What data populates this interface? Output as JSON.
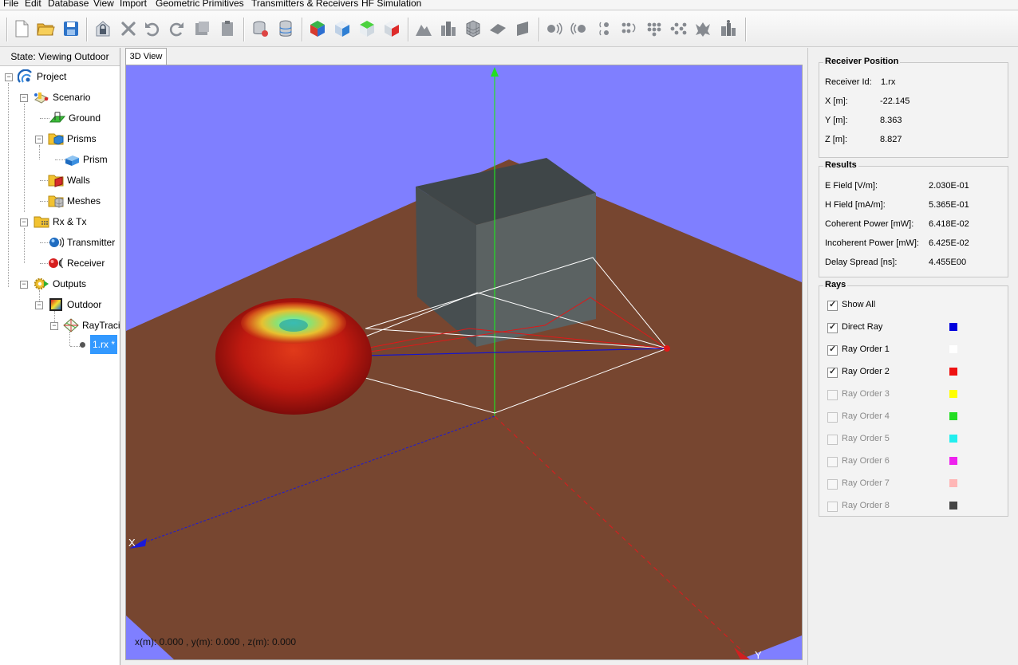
{
  "menu": [
    "File",
    "Edit",
    "Database",
    "View",
    "Import",
    "Geometric Primitives",
    "Transmitters & Receivers",
    "HF Simulation"
  ],
  "tree": {
    "state": "State: Viewing Outdoor",
    "project": "Project",
    "scenario": "Scenario",
    "ground": "Ground",
    "prisms": "Prisms",
    "prism": "Prism",
    "walls": "Walls",
    "meshes": "Meshes",
    "rxtx": "Rx & Tx",
    "transmitter": "Transmitter",
    "receiver": "Receiver",
    "outputs": "Outputs",
    "outdoor": "Outdoor",
    "raytracing": "RayTracing",
    "rx_file": "1.rx *"
  },
  "view": {
    "tab": "3D View",
    "coords": "x(m): 0.000 , y(m): 0.000 , z(m): 0.000",
    "axis_x": "X",
    "axis_y": "Y"
  },
  "receiver_position": {
    "title": "Receiver Position",
    "id_label": "Receiver Id:",
    "id_value": "1.rx",
    "x_label": "X [m]:",
    "x_value": "-22.145",
    "y_label": "Y [m]:",
    "y_value": "8.363",
    "z_label": "Z [m]:",
    "z_value": "8.827"
  },
  "results": {
    "title": "Results",
    "rows": [
      {
        "label": "E Field [V/m]:",
        "value": "2.030E-01"
      },
      {
        "label": "H Field [mA/m]:",
        "value": "5.365E-01"
      },
      {
        "label": "Coherent Power [mW]:",
        "value": "6.418E-02"
      },
      {
        "label": "Incoherent Power [mW]:",
        "value": "6.425E-02"
      },
      {
        "label": "Delay Spread [ns]:",
        "value": "4.455E00"
      }
    ]
  },
  "rays": {
    "title": "Rays",
    "show_all": "Show All",
    "items": [
      {
        "label": "Direct Ray",
        "color": "#0000dd",
        "checked": true
      },
      {
        "label": "Ray Order 1",
        "color": "#ffffff",
        "checked": true
      },
      {
        "label": "Ray Order 2",
        "color": "#ee1111",
        "checked": true
      },
      {
        "label": "Ray Order 3",
        "color": "#ffff00",
        "checked": false
      },
      {
        "label": "Ray Order 4",
        "color": "#22dd22",
        "checked": false
      },
      {
        "label": "Ray Order 5",
        "color": "#22eeee",
        "checked": false
      },
      {
        "label": "Ray Order 6",
        "color": "#ee22ee",
        "checked": false
      },
      {
        "label": "Ray Order 7",
        "color": "#ffb6b6",
        "checked": false
      },
      {
        "label": "Ray Order 8",
        "color": "#444444",
        "checked": false
      }
    ]
  }
}
